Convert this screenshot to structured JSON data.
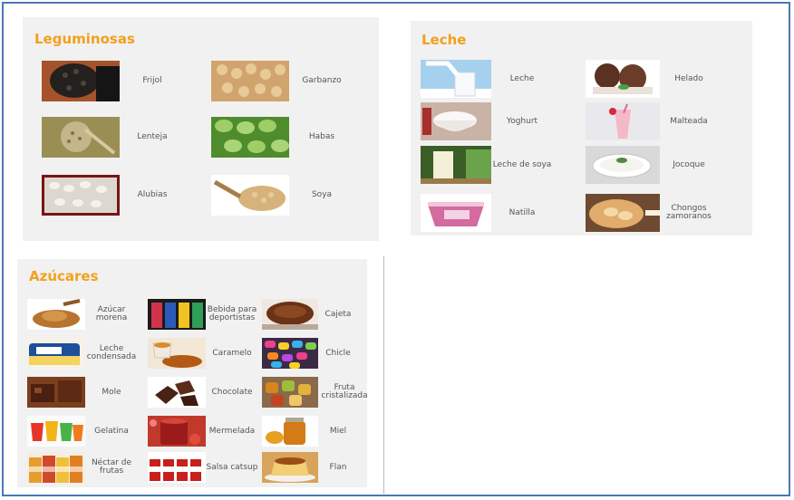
{
  "sections": {
    "leguminosas": {
      "title": "Leguminosas",
      "items": [
        {
          "label": "Frijol",
          "icon": "black-beans"
        },
        {
          "label": "Garbanzo",
          "icon": "chickpeas"
        },
        {
          "label": "Lenteja",
          "icon": "lentils"
        },
        {
          "label": "Habas",
          "icon": "fava-beans"
        },
        {
          "label": "Alubias",
          "icon": "white-beans"
        },
        {
          "label": "Soya",
          "icon": "soybeans"
        }
      ]
    },
    "leche": {
      "title": "Leche",
      "items": [
        {
          "label": "Leche",
          "icon": "milk-glass"
        },
        {
          "label": "Helado",
          "icon": "chocolate-ice-cream"
        },
        {
          "label": "Yoghurt",
          "icon": "yogurt-bowl"
        },
        {
          "label": "Malteada",
          "icon": "milkshake"
        },
        {
          "label": "Leche de soya",
          "icon": "soy-milk"
        },
        {
          "label": "Jocoque",
          "icon": "jocoque-bowl"
        },
        {
          "label": "Natilla",
          "icon": "custard-cup"
        },
        {
          "label": "Chongos zamoranos",
          "icon": "chongos-dessert"
        }
      ]
    },
    "azucares": {
      "title": "Azúcares",
      "items": [
        {
          "label": "Azúcar morena",
          "icon": "brown-sugar"
        },
        {
          "label": "Bebida para deportistas",
          "icon": "sports-drinks"
        },
        {
          "label": "Cajeta",
          "icon": "cajeta-spread"
        },
        {
          "label": "Leche condensada",
          "icon": "condensed-milk-can"
        },
        {
          "label": "Caramelo",
          "icon": "caramel-sauce"
        },
        {
          "label": "Chicle",
          "icon": "chewing-gum"
        },
        {
          "label": "Mole",
          "icon": "mole-paste"
        },
        {
          "label": "Chocolate",
          "icon": "chocolate-pieces"
        },
        {
          "label": "Fruta cristalizada",
          "icon": "candied-fruit"
        },
        {
          "label": "Gelatina",
          "icon": "gelatin-cups"
        },
        {
          "label": "Mermelada",
          "icon": "jam-jar"
        },
        {
          "label": "Miel",
          "icon": "honey-jar"
        },
        {
          "label": "Néctar de frutas",
          "icon": "nectar-bottles"
        },
        {
          "label": "Salsa catsup",
          "icon": "ketchup-bottles"
        },
        {
          "label": "Flan",
          "icon": "flan-dessert"
        }
      ]
    }
  }
}
